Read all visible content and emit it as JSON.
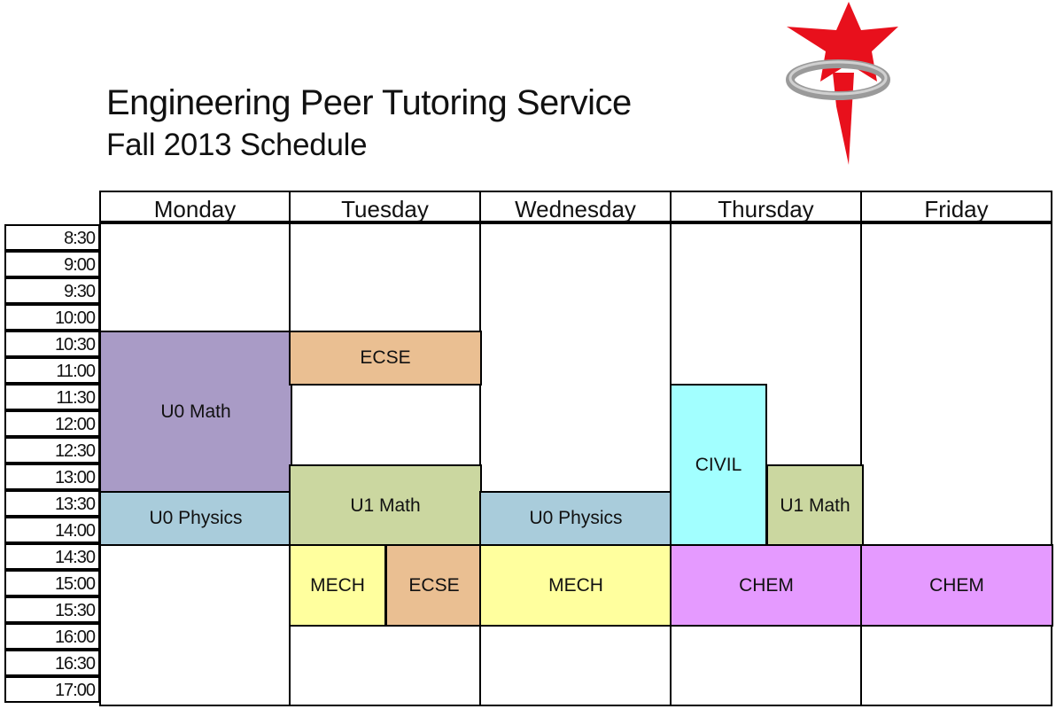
{
  "header": {
    "title": "Engineering Peer Tutoring Service",
    "subtitle": "Fall 2013 Schedule"
  },
  "logo": {
    "icon": "red-star-with-ring-logo",
    "star_color": "#e8101c",
    "ring_color": "#9a9a9a"
  },
  "days": [
    "Monday",
    "Tuesday",
    "Wednesday",
    "Thursday",
    "Friday"
  ],
  "times": [
    "8:30",
    "9:00",
    "9:30",
    "10:00",
    "10:30",
    "11:00",
    "11:30",
    "12:00",
    "12:30",
    "13:00",
    "13:30",
    "14:00",
    "14:30",
    "15:00",
    "15:30",
    "16:00",
    "16:30",
    "17:00"
  ],
  "colors": {
    "u0_math": "#a99bc6",
    "u0_physics": "#a9ccdb",
    "ecse": "#eabf92",
    "u1_math": "#cbd7a0",
    "mech": "#ffff9e",
    "civil": "#a2ffff",
    "chem": "#e59aff"
  },
  "sessions": [
    {
      "day": 0,
      "lane": 0,
      "lanes": 1,
      "start": 4,
      "span": 6,
      "label": "U0 Math",
      "color": "#a99bc6"
    },
    {
      "day": 0,
      "lane": 0,
      "lanes": 1,
      "start": 10,
      "span": 2,
      "label": "U0 Physics",
      "color": "#a9ccdb"
    },
    {
      "day": 1,
      "lane": 0,
      "lanes": 1,
      "start": 4,
      "span": 2,
      "label": "ECSE",
      "color": "#eabf92"
    },
    {
      "day": 1,
      "lane": 0,
      "lanes": 1,
      "start": 9,
      "span": 3,
      "label": "U1 Math",
      "color": "#cbd7a0"
    },
    {
      "day": 1,
      "lane": 0,
      "lanes": 2,
      "start": 12,
      "span": 3,
      "label": "MECH",
      "color": "#ffff9e"
    },
    {
      "day": 1,
      "lane": 1,
      "lanes": 2,
      "start": 12,
      "span": 3,
      "label": "ECSE",
      "color": "#eabf92"
    },
    {
      "day": 2,
      "lane": 0,
      "lanes": 1,
      "start": 10,
      "span": 2,
      "label": "U0 Physics",
      "color": "#a9ccdb"
    },
    {
      "day": 2,
      "lane": 0,
      "lanes": 1,
      "start": 12,
      "span": 3,
      "label": "MECH",
      "color": "#ffff9e"
    },
    {
      "day": 3,
      "lane": 0,
      "lanes": 2,
      "start": 6,
      "span": 6,
      "label": "CIVIL",
      "color": "#a2ffff"
    },
    {
      "day": 3,
      "lane": 1,
      "lanes": 2,
      "start": 9,
      "span": 3,
      "label": "U1 Math",
      "color": "#cbd7a0"
    },
    {
      "day": 3,
      "lane": 0,
      "lanes": 1,
      "start": 12,
      "span": 3,
      "label": "CHEM",
      "color": "#e59aff"
    },
    {
      "day": 4,
      "lane": 0,
      "lanes": 1,
      "start": 12,
      "span": 3,
      "label": "CHEM",
      "color": "#e59aff"
    }
  ]
}
